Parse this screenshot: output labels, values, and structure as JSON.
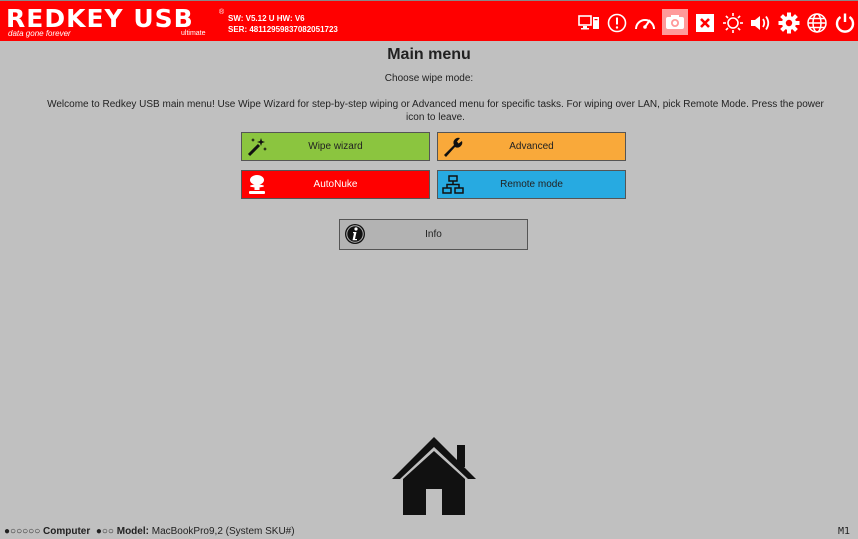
{
  "header": {
    "logo_text": "REDKEY USB",
    "logo_tagline": "data gone forever",
    "logo_edition": "ultimate",
    "logo_reg": "®",
    "sw_line": "SW: V5.12 U  HW: V6",
    "ser_line": "SER: 48112959837082051723",
    "icons": [
      "monitor-icon",
      "alert-icon",
      "speedometer-icon",
      "camera-icon",
      "close-box-icon",
      "brightness-icon",
      "volume-icon",
      "gear-icon",
      "globe-icon",
      "power-icon"
    ],
    "active_icon": "camera-icon",
    "bar_color": "#ff0000"
  },
  "main": {
    "title": "Main menu",
    "subtitle": "Choose wipe mode:",
    "welcome": "Welcome to Redkey USB main menu! Use Wipe Wizard for step-by-step wiping or Advanced menu for specific tasks. For wiping over LAN, pick Remote Mode. Press the power icon to leave."
  },
  "buttons": {
    "wizard": {
      "label": "Wipe wizard",
      "icon": "magic-wand-icon",
      "color": "#8bc53f"
    },
    "advanced": {
      "label": "Advanced",
      "icon": "wrench-icon",
      "color": "#f9a93a"
    },
    "autonuke": {
      "label": "AutoNuke",
      "icon": "mushroom-cloud-icon",
      "color": "#ff0000"
    },
    "remote": {
      "label": "Remote mode",
      "icon": "network-icon",
      "color": "#27aae1"
    },
    "info": {
      "label": "Info",
      "icon": "info-icon",
      "color": "#b3b3b3"
    }
  },
  "footer": {
    "dots1": "●○○○○○",
    "computer_label": "Computer",
    "dots2": "●○○",
    "model_label": "Model:",
    "model_value": "MacBookPro9,2 (System SKU#)",
    "mark": "M1"
  }
}
